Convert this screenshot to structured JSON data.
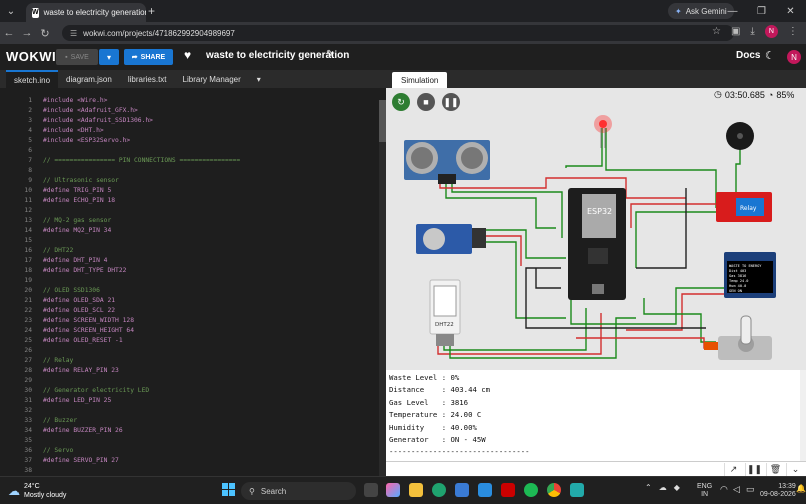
{
  "browser": {
    "tab_title": "waste to electricity generation",
    "url": "wokwi.com/projects/471862992904989697",
    "gemini_label": "Ask Gemini",
    "profile_initial": "N"
  },
  "wokwi": {
    "logo": "WOKWI",
    "save_label": "SAVE",
    "share_label": "SHARE",
    "project_title": "waste to electricity generation",
    "docs_label": "Docs",
    "user_initial": "N"
  },
  "editor": {
    "tabs": [
      "sketch.ino",
      "diagram.json",
      "libraries.txt",
      "Library Manager"
    ],
    "active_tab": "sketch.ino",
    "lines": [
      {
        "n": "1",
        "t": "#include <Wire.h>",
        "c": "pp"
      },
      {
        "n": "2",
        "t": "#include <Adafruit_GFX.h>",
        "c": "pp"
      },
      {
        "n": "3",
        "t": "#include <Adafruit_SSD1306.h>",
        "c": "pp"
      },
      {
        "n": "4",
        "t": "#include <DHT.h>",
        "c": "pp"
      },
      {
        "n": "5",
        "t": "#include <ESP32Servo.h>",
        "c": "pp"
      },
      {
        "n": "6",
        "t": "",
        "c": "id"
      },
      {
        "n": "7",
        "t": "// ================ PIN CONNECTIONS ================",
        "c": "cm"
      },
      {
        "n": "8",
        "t": "",
        "c": "id"
      },
      {
        "n": "9",
        "t": "// Ultrasonic sensor",
        "c": "cm"
      },
      {
        "n": "10",
        "t": "#define TRIG_PIN 5",
        "c": "def"
      },
      {
        "n": "11",
        "t": "#define ECHO_PIN 18",
        "c": "def"
      },
      {
        "n": "12",
        "t": "",
        "c": "id"
      },
      {
        "n": "13",
        "t": "// MQ-2 gas sensor",
        "c": "cm"
      },
      {
        "n": "14",
        "t": "#define MQ2_PIN 34",
        "c": "def"
      },
      {
        "n": "15",
        "t": "",
        "c": "id"
      },
      {
        "n": "16",
        "t": "// DHT22",
        "c": "cm"
      },
      {
        "n": "17",
        "t": "#define DHT_PIN 4",
        "c": "def"
      },
      {
        "n": "18",
        "t": "#define DHT_TYPE DHT22",
        "c": "def"
      },
      {
        "n": "19",
        "t": "",
        "c": "id"
      },
      {
        "n": "20",
        "t": "// OLED SSD1306",
        "c": "cm"
      },
      {
        "n": "21",
        "t": "#define OLED_SDA 21",
        "c": "def"
      },
      {
        "n": "22",
        "t": "#define OLED_SCL 22",
        "c": "def"
      },
      {
        "n": "23",
        "t": "#define SCREEN_WIDTH 128",
        "c": "def"
      },
      {
        "n": "24",
        "t": "#define SCREEN_HEIGHT 64",
        "c": "def"
      },
      {
        "n": "25",
        "t": "#define OLED_RESET -1",
        "c": "def"
      },
      {
        "n": "26",
        "t": "",
        "c": "id"
      },
      {
        "n": "27",
        "t": "// Relay",
        "c": "cm"
      },
      {
        "n": "28",
        "t": "#define RELAY_PIN 23",
        "c": "def"
      },
      {
        "n": "29",
        "t": "",
        "c": "id"
      },
      {
        "n": "30",
        "t": "// Generator electricity LED",
        "c": "cm"
      },
      {
        "n": "31",
        "t": "#define LED_PIN 25",
        "c": "def"
      },
      {
        "n": "32",
        "t": "",
        "c": "id"
      },
      {
        "n": "33",
        "t": "// Buzzer",
        "c": "cm"
      },
      {
        "n": "34",
        "t": "#define BUZZER_PIN 26",
        "c": "def"
      },
      {
        "n": "35",
        "t": "",
        "c": "id"
      },
      {
        "n": "36",
        "t": "// Servo",
        "c": "cm"
      },
      {
        "n": "37",
        "t": "#define SERVO_PIN 27",
        "c": "def"
      },
      {
        "n": "38",
        "t": "",
        "c": "id"
      }
    ]
  },
  "simulation": {
    "tab_label": "Simulation",
    "timer": "03:50.685",
    "speed": "85%",
    "esp_label": "ESP32",
    "relay_label": "Relay",
    "dht_label": "DHT22",
    "oled_lines": [
      "WASTE TO ENERGY",
      "Dist  403",
      "Gas   3816",
      "Temp  24.0",
      "Hum   40.0",
      "GEN   ON"
    ]
  },
  "serial": {
    "lines": [
      "Waste Level : 0%",
      "Distance    : 403.44 cm",
      "Gas Level   : 3816",
      "Temperature : 24.00 C",
      "Humidity    : 40.00%",
      "Generator   : ON - 45W",
      "--------------------------------"
    ]
  },
  "taskbar": {
    "temp": "24°C",
    "weather": "Mostly cloudy",
    "search_placeholder": "Search",
    "lang1": "ENG",
    "lang2": "IN",
    "time": "13:39",
    "date": "09-08-2026"
  },
  "colors": {
    "wokwi_blue": "#1976d2",
    "play_green": "#2e7d32",
    "wire_green": "#1b8a1b",
    "wire_red": "#d32f2f"
  }
}
